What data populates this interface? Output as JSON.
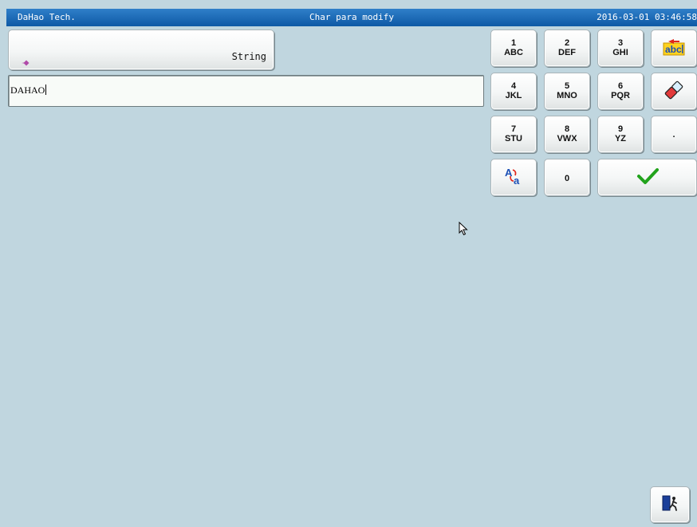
{
  "titlebar": {
    "company": "DaHao Tech.",
    "title": "Char para modify",
    "datetime": "2016-03-01 03:46:58"
  },
  "param": {
    "label": "String",
    "marker_icon": "diamond-icon"
  },
  "input": {
    "value": "DAHAO"
  },
  "keypad": {
    "keys": [
      {
        "num": "1",
        "letters": "ABC"
      },
      {
        "num": "2",
        "letters": "DEF"
      },
      {
        "num": "3",
        "letters": "GHI"
      },
      {
        "num": "4",
        "letters": "JKL"
      },
      {
        "num": "5",
        "letters": "MNO"
      },
      {
        "num": "6",
        "letters": "PQR"
      },
      {
        "num": "7",
        "letters": "STU"
      },
      {
        "num": "8",
        "letters": "VWX"
      },
      {
        "num": "9",
        "letters": "YZ"
      },
      {
        "num": "0"
      },
      {
        "num": "."
      }
    ],
    "icons": {
      "backspace": "abc-backspace-icon",
      "clear": "eraser-icon",
      "case_toggle": "case-toggle-icon",
      "confirm": "checkmark-icon",
      "exit": "exit-door-icon"
    }
  },
  "colors": {
    "background": "#c0d6df",
    "titlebar": "#1a68b5",
    "confirm_green": "#22a31c"
  }
}
